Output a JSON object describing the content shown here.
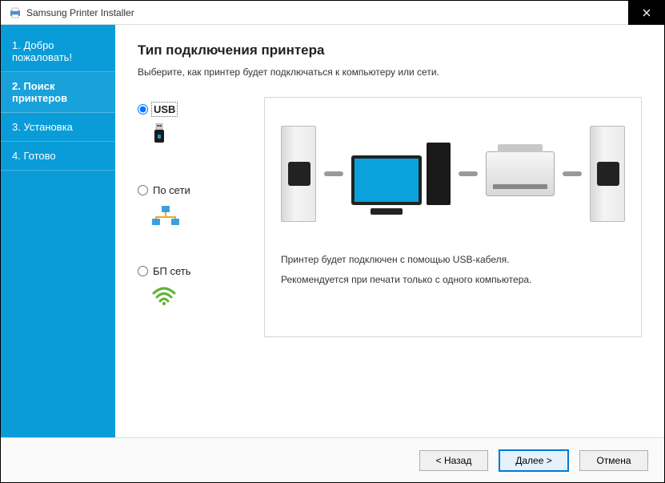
{
  "window": {
    "title": "Samsung Printer Installer"
  },
  "sidebar": {
    "steps": [
      {
        "label": "1. Добро пожаловать!"
      },
      {
        "label": "2. Поиск принтеров"
      },
      {
        "label": "3. Установка"
      },
      {
        "label": "4. Готово"
      }
    ],
    "active_index": 1
  },
  "content": {
    "heading": "Тип подключения принтера",
    "subtitle": "Выберите, как принтер будет подключаться к компьютеру или сети."
  },
  "options": [
    {
      "id": "usb",
      "label": "USB",
      "selected": true
    },
    {
      "id": "network",
      "label": "По сети",
      "selected": false
    },
    {
      "id": "wireless",
      "label": "БП сеть",
      "selected": false
    }
  ],
  "preview": {
    "line1": "Принтер будет подключен с помощью USB-кабеля.",
    "line2": "Рекомендуется при печати только с одного компьютера."
  },
  "footer": {
    "back": "< Назад",
    "next": "Далее >",
    "cancel": "Отмена"
  }
}
